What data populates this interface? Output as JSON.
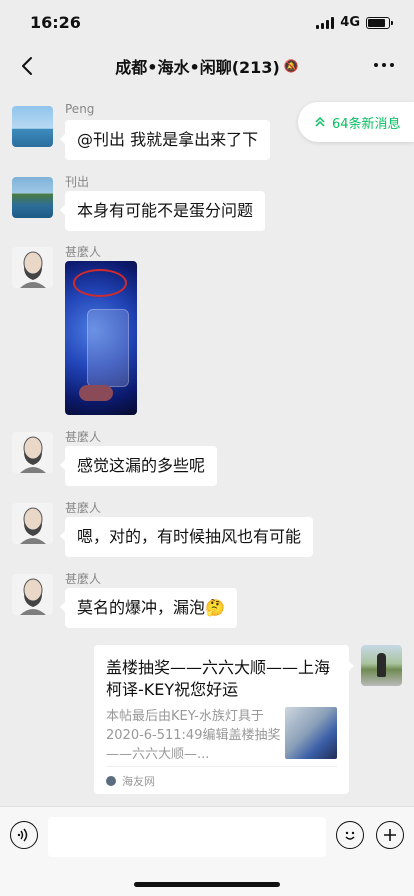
{
  "status": {
    "time": "16:26",
    "network": "4G",
    "battery_level": 0.85
  },
  "nav": {
    "title": "成都•海水•闲聊(213)"
  },
  "new_messages": {
    "label": "64条新消息"
  },
  "messages": [
    {
      "sender": "Peng",
      "text": "@刊出 我就是拿出来了下"
    },
    {
      "sender": "刊出",
      "text": "本身有可能不是蛋分问题"
    },
    {
      "sender": "甚麼人"
    },
    {
      "sender": "甚麼人",
      "text": "感觉这漏的多些呢"
    },
    {
      "sender": "甚麼人",
      "text": "嗯，对的，有时候抽风也有可能"
    },
    {
      "sender": "甚麼人",
      "text": "莫名的爆冲，漏泡🤔"
    }
  ],
  "card": {
    "title": "盖楼抽奖——六六大顺——上海柯译-KEY祝您好运",
    "desc": "本帖最后由KEY-水族灯具于2020-6-511:49编辑盖楼抽奖——六六大顺—...",
    "source": "海友网"
  },
  "input": {
    "placeholder": ""
  }
}
